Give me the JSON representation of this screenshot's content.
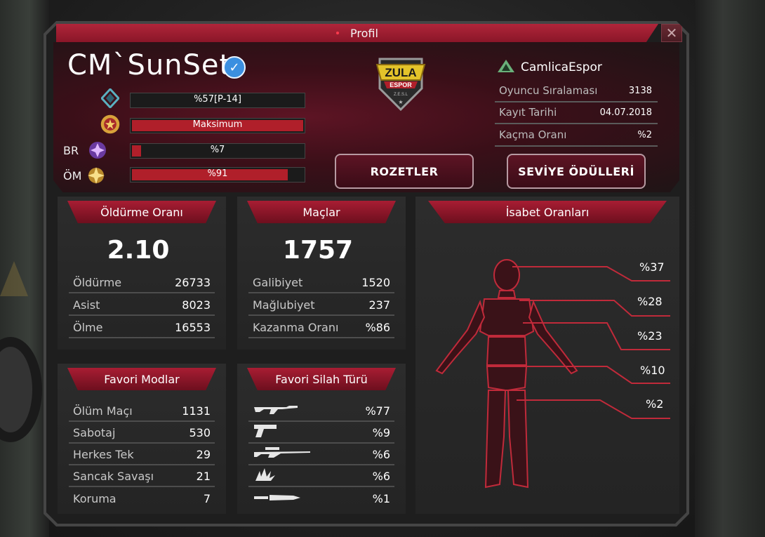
{
  "window": {
    "title": "Profil"
  },
  "player": {
    "name": "CM`SunSet"
  },
  "ranks": [
    {
      "label": "",
      "icon": "diamond-rank-icon",
      "text": "%57[P-14]",
      "fill": 0
    },
    {
      "label": "",
      "icon": "medal-rank-icon",
      "text": "Maksimum",
      "fill": 1.0
    },
    {
      "label": "BR",
      "icon": "br-rank-icon",
      "text": "%7",
      "fill": 0.07
    },
    {
      "label": "ÖM",
      "icon": "om-rank-icon",
      "text": "%91",
      "fill": 0.91
    }
  ],
  "logo": {
    "title": "ZULA",
    "subtitle": "ESPOR",
    "small": "Z.E.S.L"
  },
  "buttons": {
    "badges": "ROZETLER",
    "level_rewards": "SEVİYE ÖDÜLLERİ"
  },
  "clan": {
    "name": "CamlicaEspor",
    "rows": [
      {
        "label": "Oyuncu Sıralaması",
        "value": "3138"
      },
      {
        "label": "Kayıt Tarihi",
        "value": "04.07.2018"
      },
      {
        "label": "Kaçma Oranı",
        "value": "%2"
      }
    ]
  },
  "kill_ratio": {
    "title": "Öldürme Oranı",
    "value": "2.10",
    "rows": [
      {
        "label": "Öldürme",
        "value": "26733"
      },
      {
        "label": "Asist",
        "value": "8023"
      },
      {
        "label": "Ölme",
        "value": "16553"
      }
    ]
  },
  "matches": {
    "title": "Maçlar",
    "value": "1757",
    "rows": [
      {
        "label": "Galibiyet",
        "value": "1520"
      },
      {
        "label": "Mağlubiyet",
        "value": "237"
      },
      {
        "label": "Kazanma Oranı",
        "value": "%86"
      }
    ]
  },
  "accuracy": {
    "title": "İsabet Oranları",
    "values": [
      "%37",
      "%28",
      "%23",
      "%10",
      "%2"
    ]
  },
  "fav_modes": {
    "title": "Favori Modlar",
    "rows": [
      {
        "label": "Ölüm Maçı",
        "value": "1131"
      },
      {
        "label": "Sabotaj",
        "value": "530"
      },
      {
        "label": "Herkes Tek",
        "value": "29"
      },
      {
        "label": "Sancak Savaşı",
        "value": "21"
      },
      {
        "label": "Koruma",
        "value": "7"
      }
    ]
  },
  "fav_weapons": {
    "title": "Favori Silah Türü",
    "rows": [
      {
        "icon": "rifle-icon",
        "value": "%77"
      },
      {
        "icon": "pistol-icon",
        "value": "%9"
      },
      {
        "icon": "sniper-icon",
        "value": "%6"
      },
      {
        "icon": "grenade-icon",
        "value": "%6"
      },
      {
        "icon": "knife-icon",
        "value": "%1"
      }
    ]
  },
  "colors": {
    "accent": "#b01f2a",
    "header": "#5d1424",
    "panel": "#262626"
  }
}
